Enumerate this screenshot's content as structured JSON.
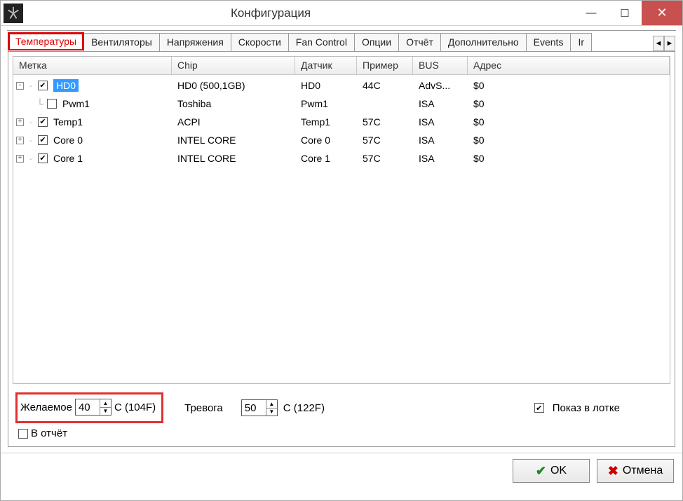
{
  "window": {
    "title": "Конфигурация"
  },
  "tabs": {
    "items": [
      "Температуры",
      "Вентиляторы",
      "Напряжения",
      "Скорости",
      "Fan Control",
      "Опции",
      "Отчёт",
      "Дополнительно",
      "Events",
      "Ir"
    ],
    "active_index": 0
  },
  "grid": {
    "headers": {
      "label": "Метка",
      "chip": "Chip",
      "sensor": "Датчик",
      "sample": "Пример",
      "bus": "BUS",
      "address": "Адрес"
    },
    "rows": [
      {
        "indent": 0,
        "expander": "-",
        "checked": true,
        "selected": true,
        "label": "HD0",
        "chip": "HD0 (500,1GB)",
        "sensor": "HD0",
        "sample": "44C",
        "bus": "AdvS...",
        "addr": "$0"
      },
      {
        "indent": 1,
        "expander": "",
        "checked": false,
        "selected": false,
        "label": "Pwm1",
        "chip": "Toshiba",
        "sensor": "Pwm1",
        "sample": "",
        "bus": "ISA",
        "addr": "$0"
      },
      {
        "indent": 0,
        "expander": "+",
        "checked": true,
        "selected": false,
        "label": "Temp1",
        "chip": "ACPI",
        "sensor": "Temp1",
        "sample": "57C",
        "bus": "ISA",
        "addr": "$0"
      },
      {
        "indent": 0,
        "expander": "+",
        "checked": true,
        "selected": false,
        "label": "Core 0",
        "chip": "INTEL CORE",
        "sensor": "Core 0",
        "sample": "57C",
        "bus": "ISA",
        "addr": "$0"
      },
      {
        "indent": 0,
        "expander": "+",
        "checked": true,
        "selected": false,
        "label": "Core 1",
        "chip": "INTEL CORE",
        "sensor": "Core 1",
        "sample": "57C",
        "bus": "ISA",
        "addr": "$0"
      }
    ]
  },
  "controls": {
    "desired_label": "Желаемое",
    "desired_value": "40",
    "desired_unit": "C (104F)",
    "alarm_label": "Тревога",
    "alarm_value": "50",
    "alarm_unit": "C (122F)",
    "show_tray_label": "Показ в лотке",
    "show_tray_checked": true,
    "in_report_label": "В отчёт",
    "in_report_checked": false
  },
  "buttons": {
    "ok": "OK",
    "cancel": "Отмена"
  }
}
